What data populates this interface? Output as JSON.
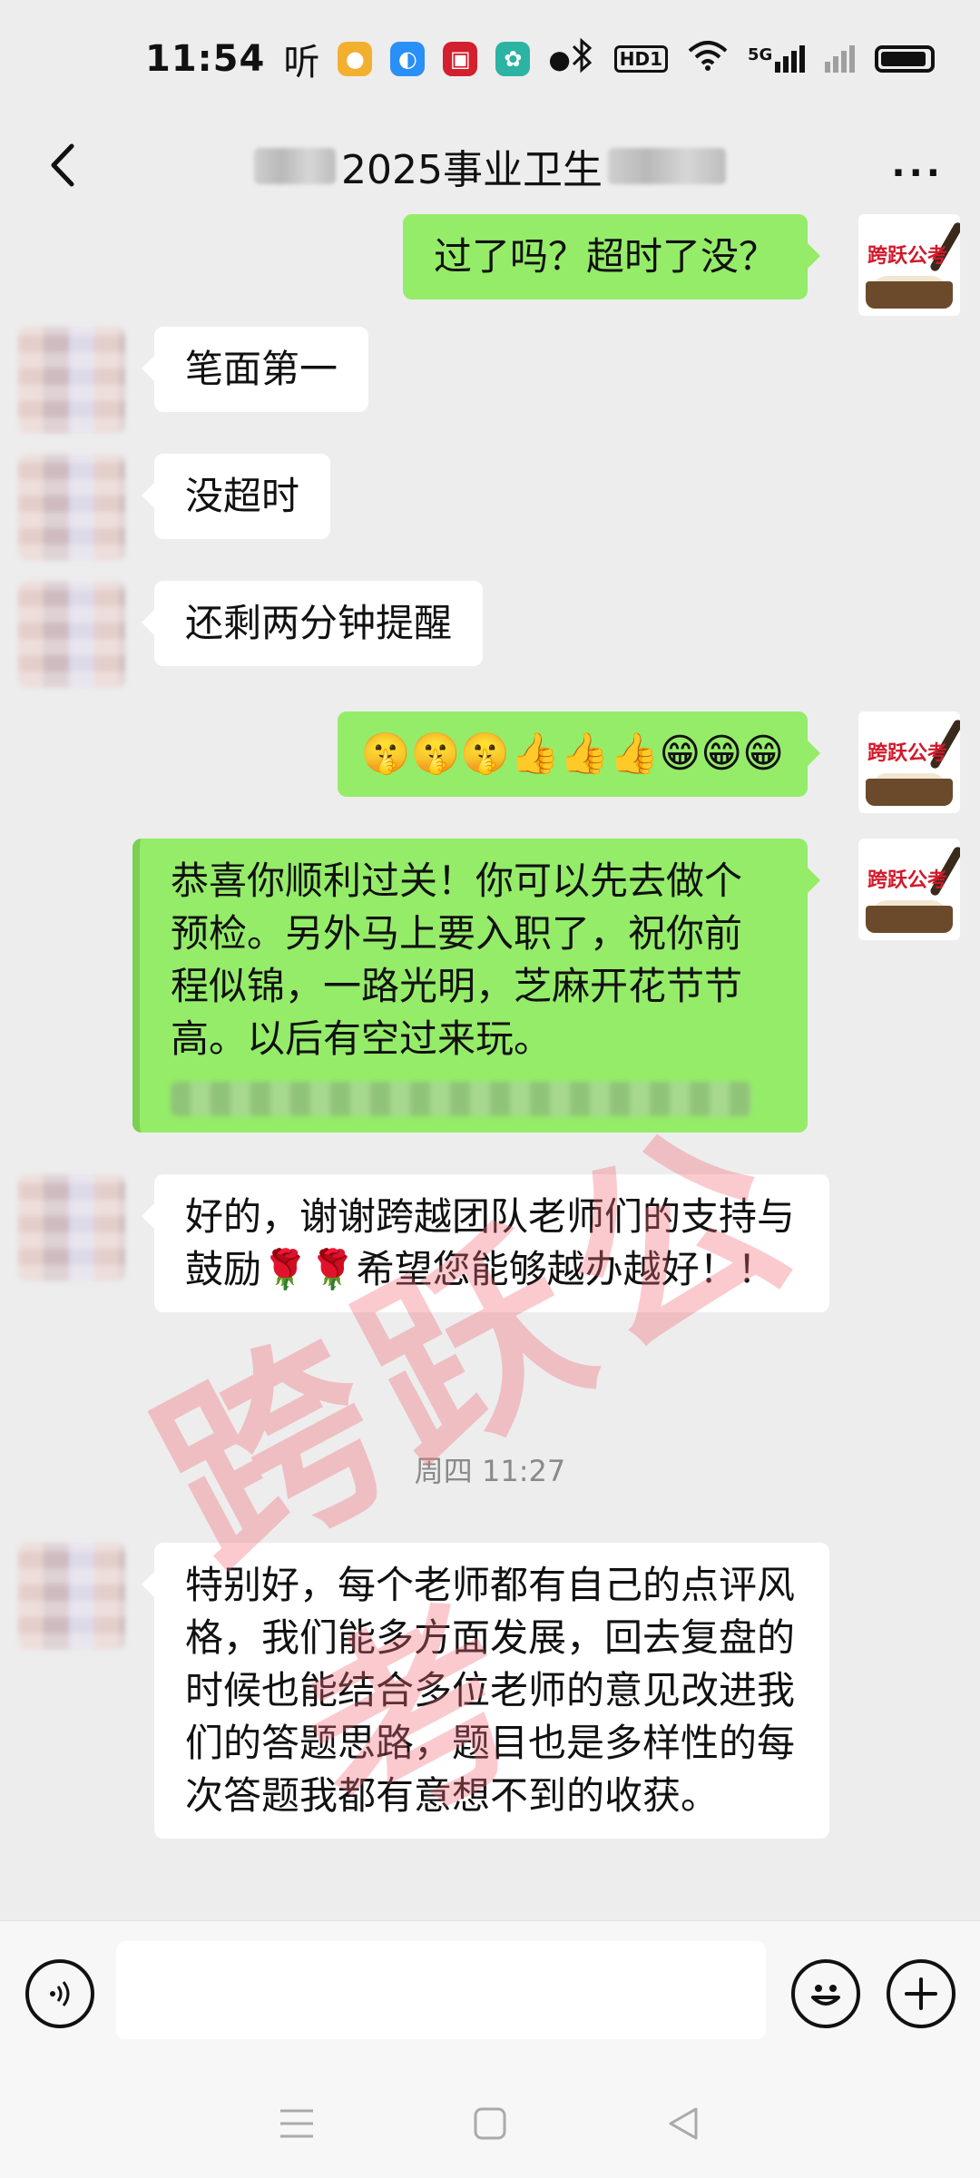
{
  "status_bar": {
    "time": "11:54",
    "listen_label": "听",
    "network_label": "5G",
    "hd_label": "HD1"
  },
  "header": {
    "title_visible": "2025事业卫生",
    "more_label": "···"
  },
  "messages": {
    "m1": "过了吗？超时了没？",
    "m2": "笔面第一",
    "m3": "没超时",
    "m4": "还剩两分钟提醒",
    "m5": "🤫🤫🤫👍👍👍😁😁😁",
    "m6": "恭喜你顺利过关！你可以先去做个预检。另外马上要入职了，祝你前程似锦，一路光明，芝麻开花节节高。以后有空过来玩。",
    "m7": "好的，谢谢跨越团队老师们的支持与鼓励🌹🌹希望您能够越办越好！！",
    "m8": "特别好，每个老师都有自己的点评风格，我们能多方面发展，回去复盘的时候也能结合多位老师的意见改进我们的答题思路，题目也是多样性的每次答题我都有意想不到的收获。"
  },
  "time_divider": "周四 11:27",
  "avatar_brand": "跨跃公考",
  "watermark_text": "跨跃公考",
  "input": {
    "placeholder": ""
  },
  "colors": {
    "sent_bubble": "#95ec69",
    "received_bubble": "#ffffff",
    "background": "#ededed"
  }
}
